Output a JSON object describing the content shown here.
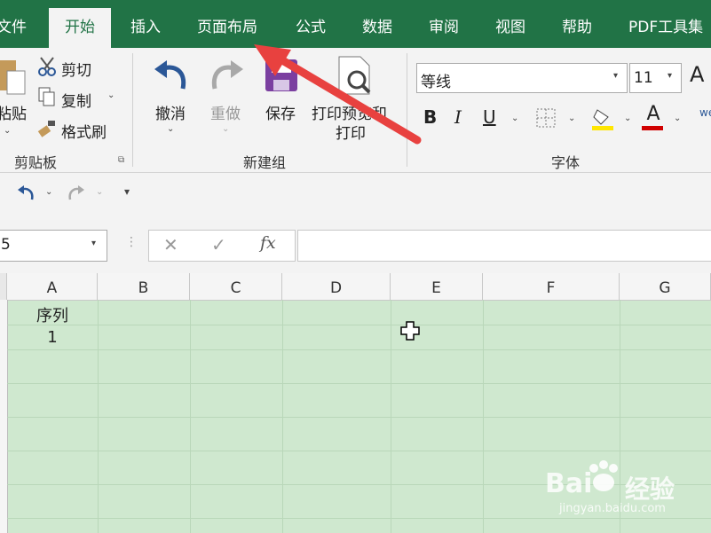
{
  "tabs": [
    "文件",
    "开始",
    "插入",
    "页面布局",
    "公式",
    "数据",
    "审阅",
    "视图",
    "帮助",
    "PDF工具集"
  ],
  "active_tab": "开始",
  "clipboard": {
    "paste": "粘贴",
    "cut": "剪切",
    "copy": "复制",
    "format_painter": "格式刷",
    "group": "剪贴板"
  },
  "newgroup": {
    "undo": "撤消",
    "redo": "重做",
    "save": "保存",
    "print_preview_line1": "打印预览和",
    "print_preview_line2": "打印",
    "group": "新建组"
  },
  "font": {
    "name": "等线",
    "size": "11",
    "group": "字体",
    "bold": "B",
    "italic": "I",
    "underline": "U",
    "font_color_glyph": "A"
  },
  "name_box": "5",
  "formula_fx": "fx",
  "columns": [
    "A",
    "B",
    "C",
    "D",
    "E",
    "F",
    "G"
  ],
  "cells": {
    "A1": "序列",
    "A2": "1"
  },
  "watermark": {
    "brand": "Bai",
    "brand2": "经验",
    "url": "jingyan.baidu.com"
  },
  "colors": {
    "excel_green": "#217346",
    "grid_bg": "#cfe8cf",
    "arrow_red": "#e8413f"
  }
}
